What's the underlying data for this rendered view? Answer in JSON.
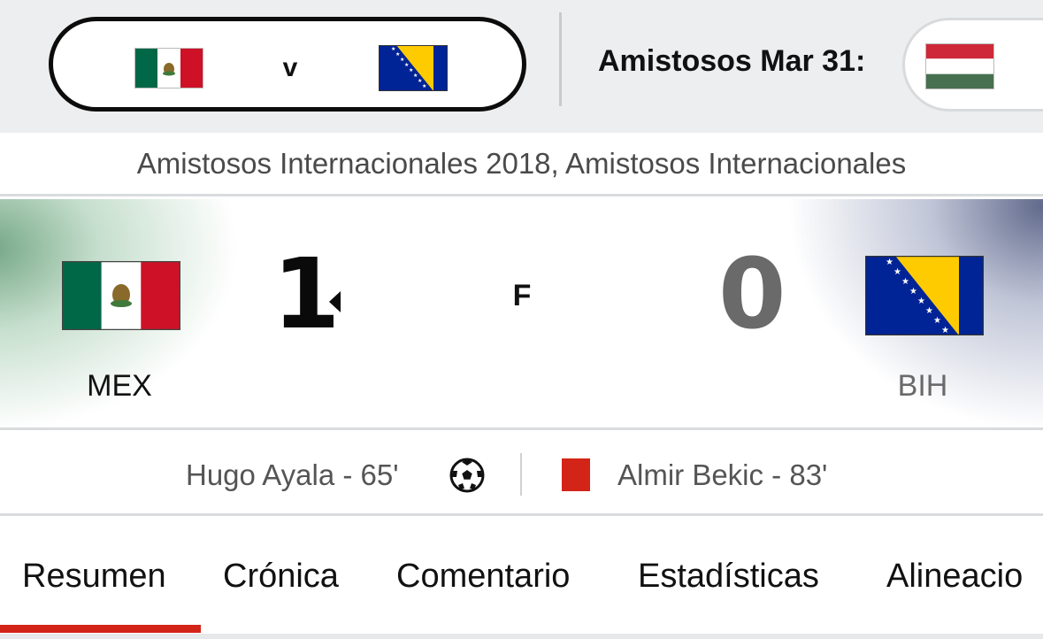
{
  "match_strip": {
    "current_match": {
      "home_flag_icon": "mexico-flag-icon",
      "separator": "v",
      "away_flag_icon": "bosnia-herzegovina-flag-icon"
    },
    "label": "Amistosos Mar 31:",
    "next_match_flag_icon": "hungary-flag-icon"
  },
  "competition": "Amistosos Internacionales 2018, Amistosos Internacionales",
  "scoreboard": {
    "home": {
      "abbr": "MEX",
      "score": "1",
      "flag_icon": "mexico-flag-icon",
      "winner": true
    },
    "status": "F",
    "away": {
      "abbr": "BIH",
      "score": "0",
      "flag_icon": "bosnia-herzegovina-flag-icon",
      "winner": false
    }
  },
  "events": {
    "home": {
      "text": "Hugo Ayala - 65'",
      "icon": "soccer-ball-icon"
    },
    "away": {
      "text": "Almir Bekic - 83'",
      "icon": "red-card-icon"
    }
  },
  "tabs": [
    {
      "label": "Resumen",
      "active": true
    },
    {
      "label": "Crónica",
      "active": false
    },
    {
      "label": "Comentario",
      "active": false
    },
    {
      "label": "Estadísticas",
      "active": false
    },
    {
      "label": "Alineacio",
      "active": false
    }
  ],
  "colors": {
    "accent_red": "#d32418",
    "mexico_green": "#006847",
    "mexico_red": "#ce1126",
    "bosnia_blue": "#002395",
    "bosnia_yellow": "#fecb00",
    "hungary_red": "#ce2939",
    "hungary_green": "#477050"
  }
}
